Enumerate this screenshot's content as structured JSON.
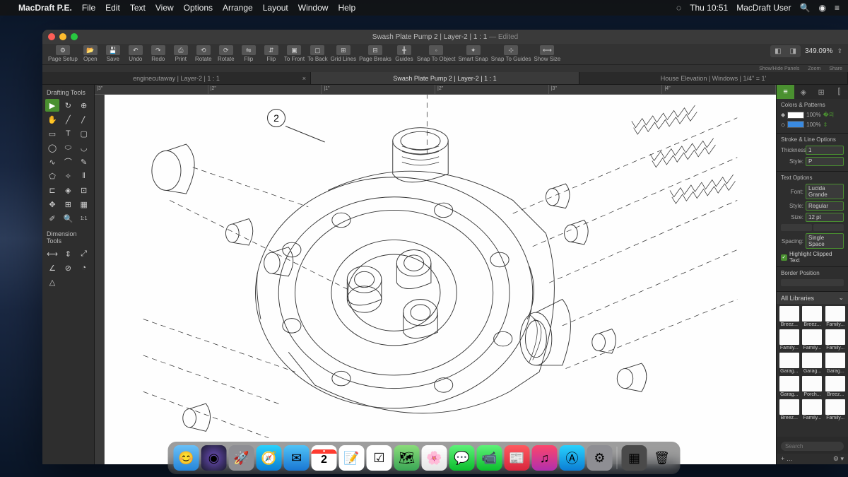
{
  "menubar": {
    "app_name": "MacDraft P.E.",
    "items": [
      "File",
      "Edit",
      "Text",
      "View",
      "Options",
      "Arrange",
      "Layout",
      "Window",
      "Help"
    ],
    "clock": "Thu 10:51",
    "user": "MacDraft User"
  },
  "window": {
    "title": "Swash Plate Pump 2 | Layer-2 | 1 : 1",
    "edited": "— Edited"
  },
  "toolbar": {
    "buttons": [
      "Page Setup",
      "Open",
      "Save",
      "Undo",
      "Redo",
      "Print",
      "Rotate",
      "Rotate",
      "Flip",
      "Flip",
      "To Front",
      "To Back",
      "Grid Lines",
      "Page Breaks",
      "Guides",
      "Snap To Object",
      "Smart Snap",
      "Snap To Guides",
      "Show Size"
    ],
    "zoom_pct": "349.09%",
    "panels_label": "Show/Hide Panels",
    "zoom_label": "Zoom",
    "share_label": "Share"
  },
  "doctabs": [
    {
      "label": "enginecutaway | Layer-2 | 1 : 1",
      "active": false
    },
    {
      "label": "Swash Plate Pump 2 | Layer-2 | 1 : 1",
      "active": true
    },
    {
      "label": "House Elevation | Windows | 1/4\" = 1'",
      "active": false
    }
  ],
  "rulers": {
    "marks": [
      "|3\"",
      "|2\"",
      "|1\"",
      "|2\"",
      "|3\"",
      "|4\""
    ]
  },
  "left_panel": {
    "drafting_title": "Drafting Tools",
    "dimension_title": "Dimension Tools"
  },
  "callout": {
    "number": "2"
  },
  "right_panel": {
    "colors_title": "Colors & Patterns",
    "fill_pct": "100%",
    "stroke_pct": "100%",
    "stroke_title": "Stroke & Line Options",
    "thickness_label": "Thickness:",
    "thickness_val": "1",
    "style_label": "Style:",
    "style_val": "P",
    "text_title": "Text Options",
    "font_label": "Font:",
    "font_val": "Lucida Grande",
    "fstyle_label": "Style:",
    "fstyle_val": "Regular",
    "size_label": "Size:",
    "size_val": "12 pt",
    "spacing_label": "Spacing:",
    "spacing_val": "Single Space",
    "highlight_label": "Highlight Clipped Text",
    "border_title": "Border Position",
    "library_title": "All Libraries",
    "library_items": [
      "Breez...",
      "Breez...",
      "Family...",
      "Family...",
      "Family...",
      "Family...",
      "Garag...",
      "Garag...",
      "Garag...",
      "Garag...",
      "Porch...",
      "Breez...",
      "Breez...",
      "Family...",
      "Family..."
    ],
    "search_placeholder": "Search"
  },
  "dock": {
    "items": [
      "finder",
      "siri",
      "launchpad",
      "safari",
      "mail",
      "calendar",
      "notes",
      "reminders",
      "maps",
      "photos",
      "messages",
      "facetime",
      "news",
      "music",
      "appstore",
      "settings"
    ],
    "calendar_day": "2",
    "trash": "trash"
  },
  "colors": {
    "accent": "#4a9030",
    "fill": "#ffffff",
    "stroke": "#3a8ae0"
  }
}
